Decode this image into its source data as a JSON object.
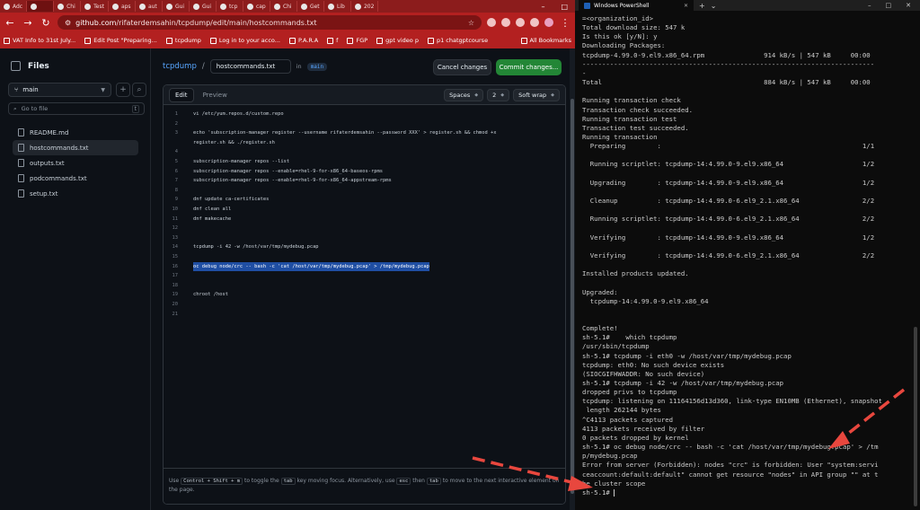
{
  "browser": {
    "tabs": [
      "Adc",
      "",
      "Chi",
      "Test",
      "aps",
      "aut",
      "Gui",
      "Gui",
      "tcp",
      "cap",
      "Chi",
      "Get",
      "Lib",
      "202"
    ],
    "url_host": "github.com",
    "url_path": "/rifaterdemsahin/tcpdump/edit/main/hostcommands.txt",
    "bookmarks": [
      "VAT Info to 31st July...",
      "Edit Post \"Preparing...",
      "tcpdump",
      "Log in to your acco...",
      "P.A.R.A",
      "f",
      "FGP",
      "gpt video p",
      "p1 chatgptcourse",
      "All Bookmarks"
    ]
  },
  "github": {
    "files_title": "Files",
    "branch": "main",
    "goto_placeholder": "Go to file",
    "goto_shortcut": "t",
    "files": [
      "README.md",
      "hostcommands.txt",
      "outputs.txt",
      "podcommands.txt",
      "setup.txt"
    ],
    "repo": "tcpdump",
    "filename": "hostcommands.txt",
    "in_label": "in",
    "branch_badge": "main",
    "cancel_label": "Cancel changes",
    "commit_label": "Commit changes...",
    "edit_tab": "Edit",
    "preview_tab": "Preview",
    "indent_mode": "Spaces",
    "indent_size": "2",
    "wrap_mode": "Soft wrap",
    "code": [
      {
        "n": "1",
        "t": "vi /etc/yum.repos.d/custom.repo"
      },
      {
        "n": "2",
        "t": ""
      },
      {
        "n": "3",
        "t": "echo 'subscription-manager register --username rifaterdemsahin --password XXX' > register.sh && chmod +x"
      },
      {
        "n": "",
        "t": "register.sh && ./register.sh"
      },
      {
        "n": "4",
        "t": ""
      },
      {
        "n": "5",
        "t": "subscription-manager repos --list"
      },
      {
        "n": "6",
        "t": "subscription-manager repos --enable=rhel-9-for-x86_64-baseos-rpms"
      },
      {
        "n": "7",
        "t": "subscription-manager repos --enable=rhel-9-for-x86_64-appstream-rpms"
      },
      {
        "n": "8",
        "t": ""
      },
      {
        "n": "9",
        "t": "dnf update ca-certificates"
      },
      {
        "n": "10",
        "t": "dnf clean all"
      },
      {
        "n": "11",
        "t": "dnf makecache"
      },
      {
        "n": "12",
        "t": ""
      },
      {
        "n": "13",
        "t": ""
      },
      {
        "n": "14",
        "t": "tcpdump -i 42 -w /host/var/tmp/mydebug.pcap"
      },
      {
        "n": "15",
        "t": ""
      },
      {
        "n": "16",
        "t": "oc debug node/crc -- bash -c 'cat /host/var/tmp/mydebug.pcap' > /tmp/mydebug.pcap"
      },
      {
        "n": "17",
        "t": ""
      },
      {
        "n": "18",
        "t": ""
      },
      {
        "n": "19",
        "t": "chroot /host"
      },
      {
        "n": "20",
        "t": ""
      },
      {
        "n": "21",
        "t": ""
      }
    ],
    "tip": {
      "use": "Use",
      "keys": "Control + Shift + m",
      "mid1": "to toggle the",
      "tab": "tab",
      "mid2": "key moving focus. Alternatively, use",
      "esc": "esc",
      "then": "then",
      "tab2": "tab",
      "end": "to move to the next interactive element on the page."
    }
  },
  "powershell": {
    "title": "Windows PowerShell",
    "lines": [
      "=<organization_id>",
      "Total download size: 547 k",
      "Is this ok [y/N]: y",
      "Downloading Packages:",
      "tcpdump-4.99.0-9.el9.x86_64.rpm               914 kB/s | 547 kB     00:00",
      "--------------------------------------------------------------------------",
      "-",
      "Total                                         884 kB/s | 547 kB     00:00",
      "",
      "Running transaction check",
      "Transaction check succeeded.",
      "Running transaction test",
      "Transaction test succeeded.",
      "Running transaction",
      "  Preparing        :                                                   1/1",
      "",
      "  Running scriptlet: tcpdump-14:4.99.0-9.el9.x86_64                    1/2",
      "",
      "  Upgrading        : tcpdump-14:4.99.0-9.el9.x86_64                    1/2",
      "",
      "  Cleanup          : tcpdump-14:4.99.0-6.el9_2.1.x86_64                2/2",
      "",
      "  Running scriptlet: tcpdump-14:4.99.0-6.el9_2.1.x86_64                2/2",
      "",
      "  Verifying        : tcpdump-14:4.99.0-9.el9.x86_64                    1/2",
      "",
      "  Verifying        : tcpdump-14:4.99.0-6.el9_2.1.x86_64                2/2",
      "",
      "Installed products updated.",
      "",
      "Upgraded:",
      "  tcpdump-14:4.99.0-9.el9.x86_64",
      "",
      "",
      "Complete!",
      "sh-5.1#    which tcpdump",
      "/usr/sbin/tcpdump",
      "sh-5.1# tcpdump -i eth0 -w /host/var/tmp/mydebug.pcap",
      "tcpdump: eth0: No such device exists",
      "(SIOCGIFHWADDR: No such device)",
      "sh-5.1# tcpdump -i 42 -w /host/var/tmp/mydebug.pcap",
      "dropped privs to tcpdump",
      "tcpdump: listening on 11164156d13d360, link-type EN10MB (Ethernet), snapshot",
      " length 262144 bytes",
      "^C4113 packets captured",
      "4113 packets received by filter",
      "0 packets dropped by kernel",
      "sh-5.1# oc debug node/crc -- bash -c 'cat /host/var/tmp/mydebug.pcap' > /tm",
      "p/mydebug.pcap",
      "Error from server (Forbidden): nodes \"crc\" is forbidden: User \"system:servi",
      "ceaccount:default:default\" cannot get resource \"nodes\" in API group \"\" at t",
      "he cluster scope",
      "sh-5.1# "
    ]
  },
  "colors": {
    "browser_red": "#b32020",
    "commit_green": "#238636",
    "arrow_red": "#e8473e",
    "highlight": "#1f4ea3"
  }
}
